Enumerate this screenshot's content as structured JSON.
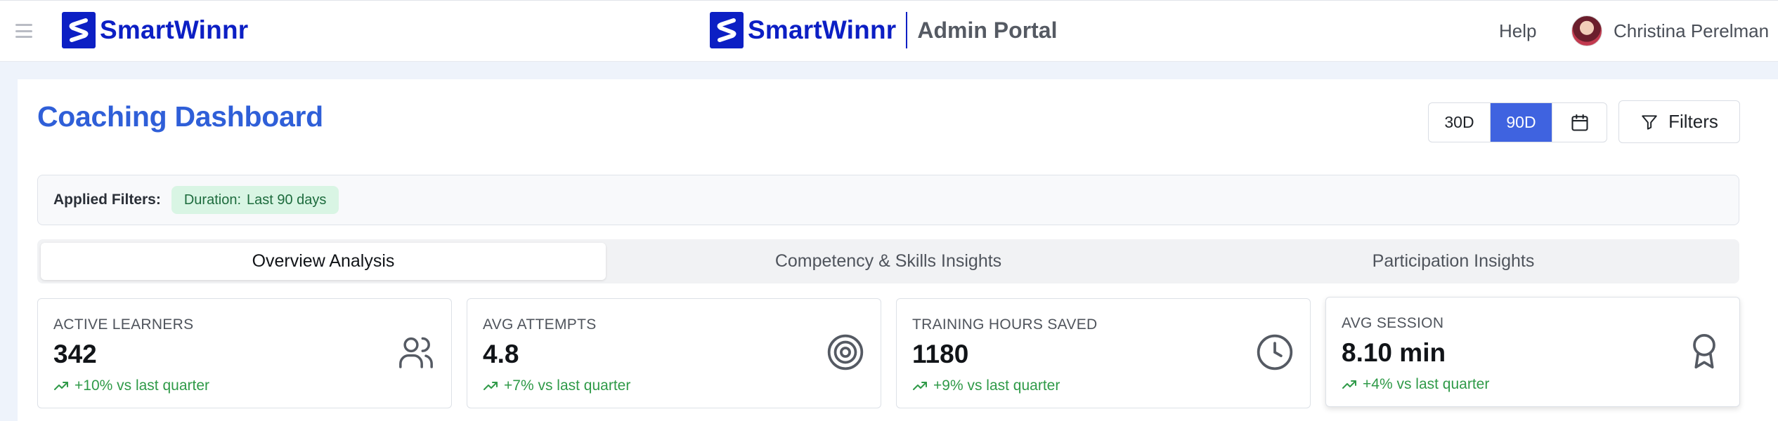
{
  "header": {
    "brand_name": "SmartWinnr",
    "portal_title": "Admin Portal",
    "help_label": "Help",
    "user_name": "Christina Perelman",
    "icons": [
      "hamburger-menu-icon",
      "smartwinnr-logo-icon",
      "user-avatar"
    ]
  },
  "page": {
    "title": "Coaching Dashboard",
    "range_buttons": [
      "30D",
      "90D"
    ],
    "active_range": "90D",
    "filters_label": "Filters"
  },
  "applied_filters": {
    "label": "Applied Filters:",
    "chip_key": "Duration:",
    "chip_value": "Last 90 days"
  },
  "tabs": [
    {
      "label": "Overview Analysis",
      "active": true
    },
    {
      "label": "Competency & Skills Insights",
      "active": false
    },
    {
      "label": "Participation Insights",
      "active": false
    }
  ],
  "kpis": [
    {
      "label": "ACTIVE LEARNERS",
      "value": "342",
      "delta": "+10% vs last quarter",
      "icon": "users-icon"
    },
    {
      "label": "AVG ATTEMPTS",
      "value": "4.8",
      "delta": "+7% vs last quarter",
      "icon": "target-icon"
    },
    {
      "label": "TRAINING HOURS SAVED",
      "value": "1180",
      "delta": "+9% vs last quarter",
      "icon": "clock-icon"
    },
    {
      "label": "AVG SESSION",
      "value": "8.10 min",
      "delta": "+4% vs last quarter",
      "icon": "award-icon"
    }
  ],
  "colors": {
    "brand": "#0c1fc4",
    "title": "#2f5fd8",
    "active_range": "#3f63e0",
    "chip_bg": "#d9f5e4",
    "positive": "#2f9a48"
  }
}
